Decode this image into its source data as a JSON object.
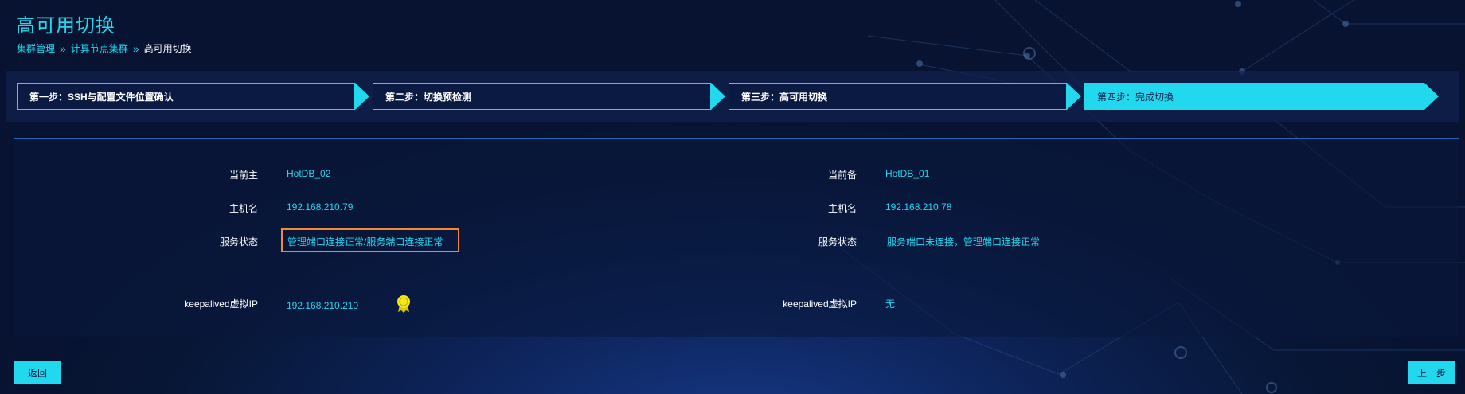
{
  "page": {
    "title": "高可用切换",
    "breadcrumb": [
      "集群管理",
      "计算节点集群",
      "高可用切换"
    ],
    "separator": "»"
  },
  "steps": [
    {
      "label": "第一步：SSH与配置文件位置确认",
      "active": false
    },
    {
      "label": "第二步：切换预检测",
      "active": false
    },
    {
      "label": "第三步：高可用切换",
      "active": false
    },
    {
      "label": "第四步：完成切换",
      "active": true
    }
  ],
  "master": {
    "role_label": "当前主",
    "role_value": "HotDB_02",
    "host_label": "主机名",
    "host_value": "192.168.210.79",
    "status_label": "服务状态",
    "status_value": "管理端口连接正常/服务端口连接正常",
    "vip_label": "keepalived虚拟IP",
    "vip_value": "192.168.210.210"
  },
  "standby": {
    "role_label": "当前备",
    "role_value": "HotDB_01",
    "host_label": "主机名",
    "host_value": "192.168.210.78",
    "status_label": "服务状态",
    "status_value": "服务端口未连接，管理端口连接正常",
    "vip_label": "keepalived虚拟IP",
    "vip_value": "无"
  },
  "buttons": {
    "back": "返回",
    "prev": "上一步"
  },
  "icons": {
    "vip_badge": "award-badge-icon"
  },
  "colors": {
    "accent": "#22d8ee",
    "highlight_border": "#f08a3a",
    "badge": "#f5e71a",
    "panel_border": "#1e6ab4"
  }
}
